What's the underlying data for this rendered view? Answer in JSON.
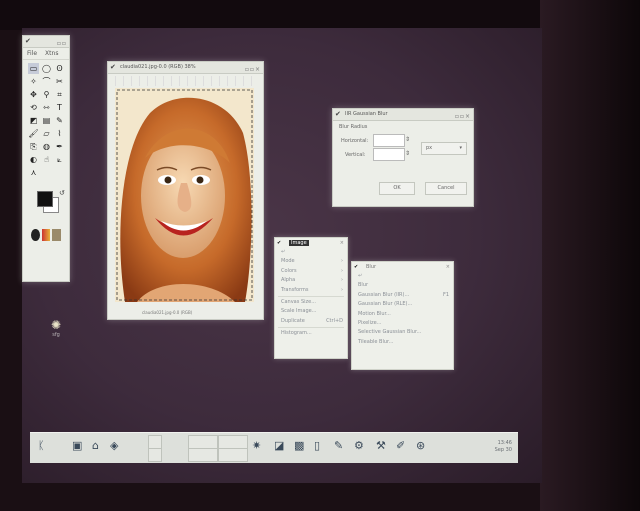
{
  "toolbox": {
    "menu": [
      "File",
      "Xtns"
    ]
  },
  "image_window": {
    "title": "claudia021.jpg-0.0 (RGB) 38%",
    "status": "claudia021.jpg-0.0 (RGB)"
  },
  "gaussian_dialog": {
    "title": "IIR Gaussian Blur",
    "blur_radius_label": "Blur Radius",
    "horizontal_label": "Horizontal:",
    "vertical_label": "Vertical:",
    "horizontal_value": "",
    "vertical_value": "",
    "unit": "px",
    "ok_label": "OK",
    "cancel_label": "Cancel"
  },
  "image_menu": {
    "title": "Image",
    "items": [
      {
        "label": "Mode",
        "acc": "›"
      },
      {
        "label": "Colors",
        "acc": "›"
      },
      {
        "label": "Alpha",
        "acc": "›"
      },
      {
        "label": "Transforms",
        "acc": "›"
      },
      {
        "label": "Canvas Size...",
        "acc": ""
      },
      {
        "label": "Scale Image...",
        "acc": ""
      },
      {
        "label": "Duplicate",
        "acc": "Ctrl+D"
      },
      {
        "label": "Histogram...",
        "acc": ""
      }
    ]
  },
  "blur_menu": {
    "title": "Blur",
    "items": [
      {
        "label": "Blur",
        "acc": ""
      },
      {
        "label": "Gaussian Blur (IIR)...",
        "acc": "F1"
      },
      {
        "label": "Gaussian Blur (RLE)...",
        "acc": ""
      },
      {
        "label": "Motion Blur...",
        "acc": ""
      },
      {
        "label": "Pixelize...",
        "acc": ""
      },
      {
        "label": "Selective Gaussian Blur...",
        "acc": ""
      },
      {
        "label": "Tileable Blur...",
        "acc": ""
      }
    ]
  },
  "desktop_icon": {
    "label": "sfg"
  },
  "taskbar": {
    "clock_time": "13:46",
    "clock_date": "Sep 30"
  },
  "colors": {
    "projection_bg": "#3d2b3c",
    "panel": "#eceee8",
    "menu_text": "#8a8f96"
  },
  "icons": [
    "pointer-icon",
    "rect-select-icon",
    "ellipse-select-icon",
    "lasso-icon",
    "magic-wand-icon",
    "bezier-icon",
    "scissors-icon",
    "move-icon",
    "magnify-icon",
    "crop-icon",
    "transform-icon",
    "flip-icon",
    "text-icon",
    "bucket-icon",
    "blend-icon",
    "pencil-icon",
    "brush-icon",
    "eraser-icon",
    "airbrush-icon",
    "clone-icon",
    "convolve-icon",
    "ink-icon",
    "dodge-icon",
    "smudge-icon",
    "measure-icon"
  ]
}
